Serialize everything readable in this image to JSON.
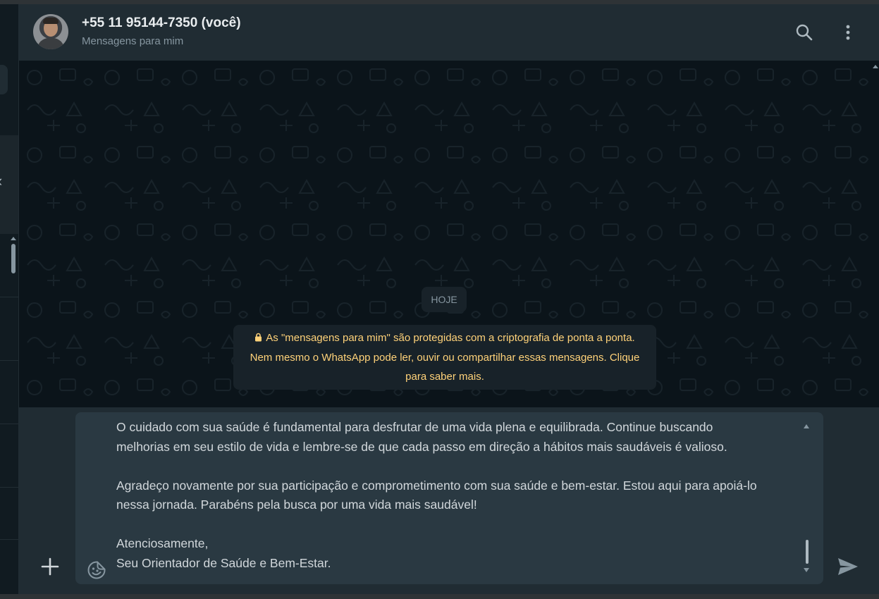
{
  "header": {
    "title": "+55 11 95144-7350 (você)",
    "subtitle": "Mensagens para mim"
  },
  "icons": {
    "search": "search-icon",
    "menu": "vertical-dots-icon",
    "add": "plus-icon",
    "sticker": "sticker-icon",
    "send": "send-icon",
    "lock": "lock-icon"
  },
  "chat": {
    "date_label": "HOJE",
    "encryption_lines": [
      "As \"mensagens para mim\" são protegidas com a criptografia de ponta a ponta.",
      "Nem mesmo o WhatsApp pode ler, ouvir ou compartilhar essas mensagens. Clique",
      "para saber mais."
    ]
  },
  "composer": {
    "text": "O cuidado com sua saúde é fundamental para desfrutar de uma vida plena e equilibrada. Continue buscando\nmelhorias em seu estilo de vida e lembre-se de que cada passo em direção a hábitos mais saudáveis é valioso.\n\nAgradeço novamente por sua participação e comprometimento com sua saúde e bem-estar. Estou aqui para apoiá-lo\nnessa jornada. Parabéns pela busca por uma vida mais saudável!\n\nAtenciosamente,\nSeu Orientador de Saúde e Bem-Estar."
  },
  "colors": {
    "header_bg": "#202c33",
    "chat_bg": "#0b141a",
    "system_text": "#ffd279",
    "composer_bg": "#2a3942"
  }
}
